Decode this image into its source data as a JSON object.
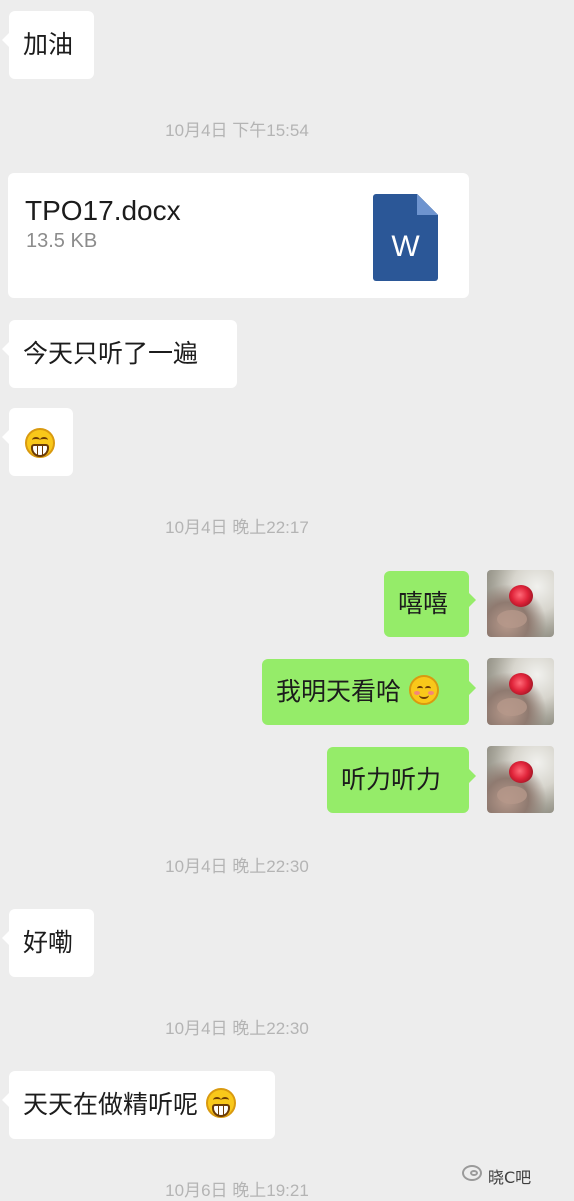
{
  "messages": {
    "m1": "加油",
    "ts1": "10月4日 下午15:54",
    "file": {
      "name": "TPO17.docx",
      "size": "13.5 KB",
      "type_letter": "W",
      "icon": "word-document-icon"
    },
    "m2": "今天只听了一遍",
    "m3_emoji": "grin-emoji",
    "ts2": "10月4日 晚上22:17",
    "m4": "嘻嘻",
    "m5": "我明天看哈",
    "m5_emoji": "smile-emoji",
    "m6": "听力听力",
    "ts3": "10月4日 晚上22:30",
    "m7": "好嘞",
    "ts4": "10月4日 晚上22:30",
    "m8": "天天在做精听呢",
    "m8_emoji": "grin-emoji",
    "ts5": "10月6日 晚上19:21"
  },
  "watermark": {
    "text": "晓C吧",
    "icon": "wechat-official-account-icon"
  },
  "colors": {
    "background": "#ededed",
    "incoming_bubble": "#ffffff",
    "outgoing_bubble": "#95ec69",
    "word_blue": "#2b5797",
    "timestamp": "#b4b4b4"
  }
}
